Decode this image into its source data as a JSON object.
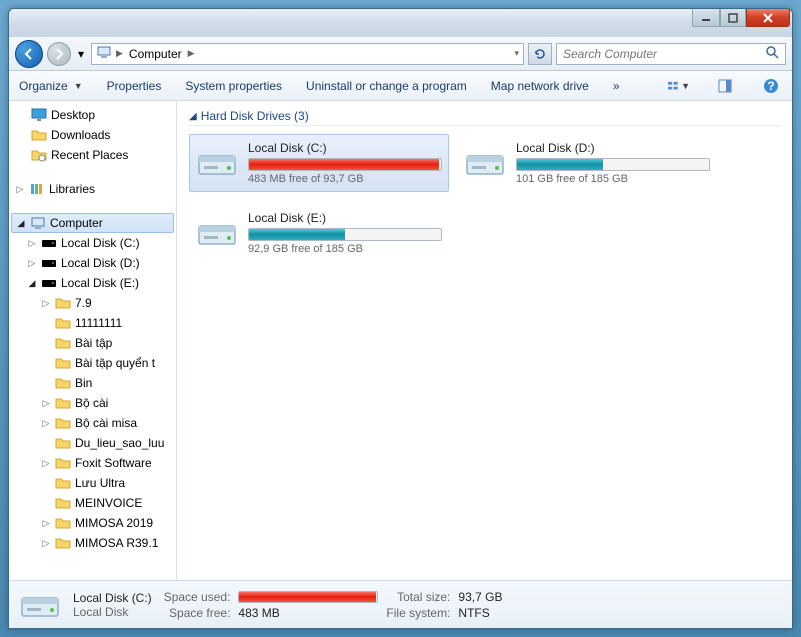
{
  "address": {
    "location": "Computer"
  },
  "search": {
    "placeholder": "Search Computer"
  },
  "toolbar": {
    "organize": "Organize",
    "properties": "Properties",
    "systemProperties": "System properties",
    "uninstall": "Uninstall or change a program",
    "mapDrive": "Map network drive"
  },
  "sidebar": {
    "desktop": "Desktop",
    "downloads": "Downloads",
    "recent": "Recent Places",
    "libraries": "Libraries",
    "computer": "Computer",
    "diskC": "Local Disk (C:)",
    "diskD": "Local Disk (D:)",
    "diskE": "Local Disk (E:)",
    "folders": {
      "f0": "7.9",
      "f1": "11111111",
      "f2": "Bài tập",
      "f3": "Bài tập quyển t",
      "f4": "Bin",
      "f5": "Bộ cài",
      "f6": "Bộ cài misa",
      "f7": "Du_lieu_sao_luu",
      "f8": "Foxit Software",
      "f9": "Lưu Ultra",
      "f10": "MEINVOICE",
      "f11": "MIMOSA 2019",
      "f12": "MIMOSA R39.1"
    }
  },
  "content": {
    "groupTitle": "Hard Disk Drives (3)",
    "drives": {
      "c": {
        "name": "Local Disk (C:)",
        "free": "483 MB free of 93,7 GB",
        "pct": 99,
        "color": "red"
      },
      "d": {
        "name": "Local Disk (D:)",
        "free": "101 GB free of 185 GB",
        "pct": 45,
        "color": "teal"
      },
      "e": {
        "name": "Local Disk (E:)",
        "free": "92,9 GB free of 185 GB",
        "pct": 50,
        "color": "teal"
      }
    }
  },
  "status": {
    "title": "Local Disk (C:)",
    "subtitle": "Local Disk",
    "spaceUsedLabel": "Space used:",
    "spaceFreeLabel": "Space free:",
    "spaceFreeVal": "483 MB",
    "totalSizeLabel": "Total size:",
    "totalSizeVal": "93,7 GB",
    "fsLabel": "File system:",
    "fsVal": "NTFS"
  }
}
